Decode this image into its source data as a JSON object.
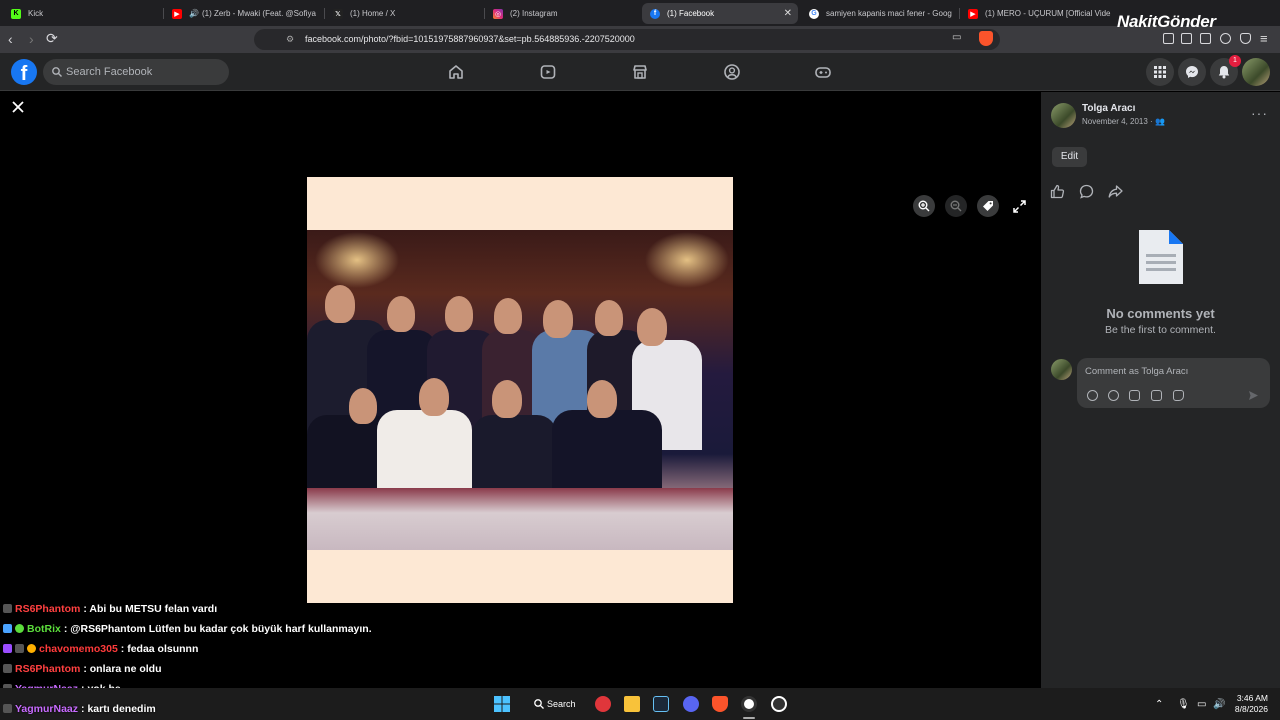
{
  "browser": {
    "tabs": [
      {
        "label": "Kick",
        "icon": "kick-icon",
        "color": "#53fc18"
      },
      {
        "label": "(1) Zerb - Mwaki (Feat. @Sofiya",
        "icon": "youtube-icon",
        "color": "#ff0000"
      },
      {
        "label": "(1) Home / X",
        "icon": "x-icon",
        "color": "#000000"
      },
      {
        "label": "(2) Instagram",
        "icon": "instagram-icon",
        "color": "#e1306c"
      },
      {
        "label": "(1) Facebook",
        "icon": "facebook-icon",
        "color": "#1877f2",
        "active": true
      },
      {
        "label": "samiyen kapanis maci fener - Goog",
        "icon": "google-icon",
        "color": "#4285f4"
      },
      {
        "label": "(1) MERO - UÇURUM [Official Vide",
        "icon": "youtube-icon",
        "color": "#ff0000"
      }
    ],
    "url": "facebook.com/photo/?fbid=10151975887960937&set=pb.564885936.-2207520000",
    "brand_overlay": "NakitGönder"
  },
  "facebook": {
    "search_placeholder": "Search Facebook",
    "notification_count": "1",
    "nav_icons": [
      "home-icon",
      "video-icon",
      "marketplace-icon",
      "groups-icon",
      "gaming-icon"
    ]
  },
  "post": {
    "author": "Tolga Aracı",
    "date": "November 4, 2013 ·",
    "edit_label": "Edit",
    "no_comments_title": "No comments yet",
    "no_comments_sub": "Be the first to comment.",
    "comment_placeholder": "Comment as Tolga Aracı"
  },
  "chat": [
    {
      "user": "RS6Phantom",
      "color": "#ff4040",
      "message": ": Abi bu METSU felan vardı"
    },
    {
      "user": "BotRix",
      "color": "#5cdd3c",
      "message": ": @RS6Phantom Lütfen bu kadar çok büyük harf kullanmayın."
    },
    {
      "user": "chavomemo305",
      "color": "#ff3b3b",
      "message": ": fedaa olsunnn"
    },
    {
      "user": "RS6Phantom",
      "color": "#ff4040",
      "message": ": onlara ne oldu"
    },
    {
      "user": "YagmurNaaz",
      "color": "#c86bff",
      "message": ": yok be"
    },
    {
      "user": "YagmurNaaz",
      "color": "#c86bff",
      "message": ": kartı denedim"
    }
  ],
  "taskbar": {
    "search_label": "Search",
    "time": "3:46 AM",
    "date": "8/8/2026"
  }
}
